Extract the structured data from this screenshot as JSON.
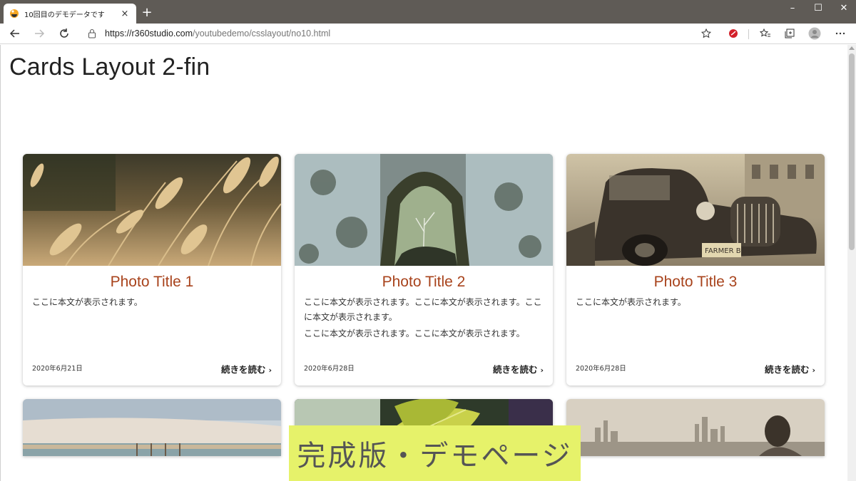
{
  "browser": {
    "tab_title": "10回目のデモデータです",
    "tab_close": "×",
    "new_tab": "+",
    "url_host": "https://r360studio.com",
    "url_path": "/youtubedemo/csslayout/no10.html",
    "window_controls": {
      "minimize": "–",
      "maximize": "☐",
      "close": "✕"
    },
    "icons": [
      "back-icon",
      "forward-icon",
      "refresh-icon",
      "lock-icon",
      "star-icon",
      "extension-icon",
      "favorites-icon",
      "collections-icon",
      "profile-icon",
      "more-icon"
    ]
  },
  "page": {
    "title": "Cards Layout 2-fin",
    "cards": [
      {
        "title": "Photo Title 1",
        "body": [
          "ここに本文が表示されます。"
        ],
        "date": "2020年6月21日",
        "more": "続きを読む",
        "image": "wheat-grass-photo"
      },
      {
        "title": "Photo Title 2",
        "body": [
          "ここに本文が表示されます。ここに本文が表示されます。ここに本文が表示されます。",
          "ここに本文が表示されます。ここに本文が表示されます。"
        ],
        "date": "2020年6月28日",
        "more": "続きを読む",
        "image": "rock-arch-photo"
      },
      {
        "title": "Photo Title 3",
        "body": [
          "ここに本文が表示されます。"
        ],
        "date": "2020年6月28日",
        "more": "続きを読む",
        "image": "vintage-truck-photo"
      }
    ],
    "partial_cards": [
      "beach-pier-photo",
      "green-leaf-photo",
      "city-skyline-photo"
    ]
  },
  "banner": {
    "text": "完成版・デモページ"
  },
  "colors": {
    "accent": "#a8431c",
    "banner_bg": "#e6f26a",
    "tabstrip": "#5f5b56"
  }
}
